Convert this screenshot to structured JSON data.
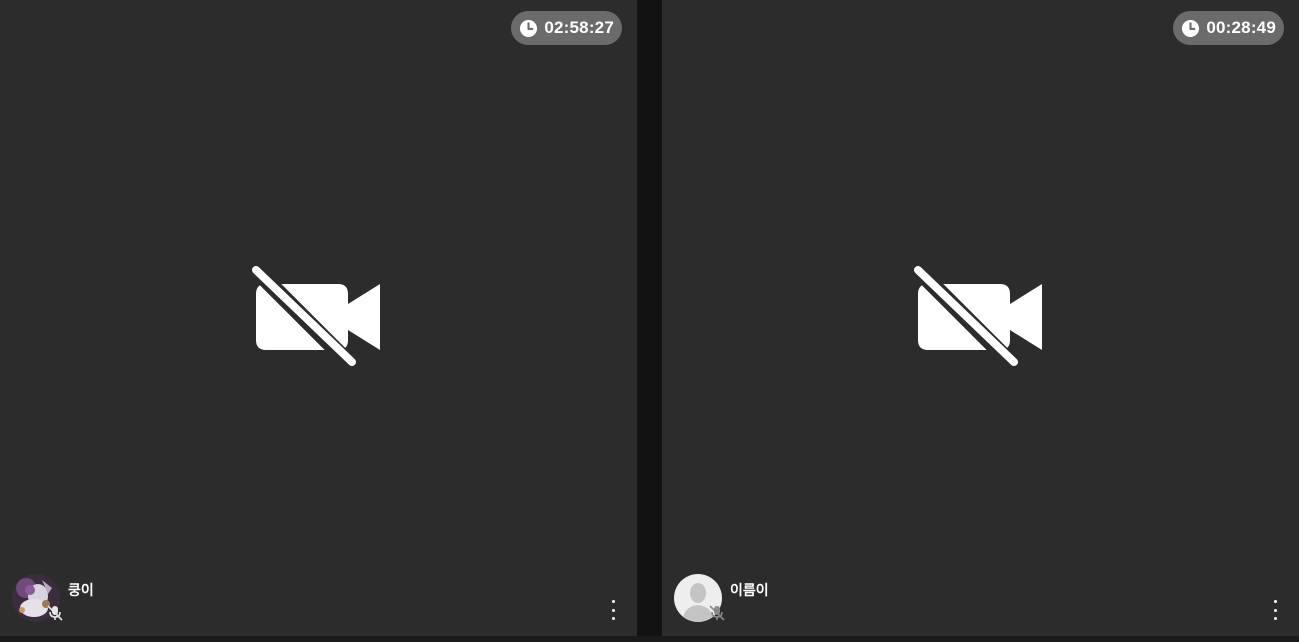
{
  "participants": [
    {
      "name": "쿵이",
      "timer": "02:58:27",
      "avatar_icon": "custom-photo-avatar",
      "camera_icon": "video-off-icon",
      "mic_icon": "mic-off-icon"
    },
    {
      "name": "이름이",
      "timer": "00:28:49",
      "avatar_icon": "default-person-avatar",
      "camera_icon": "video-off-icon",
      "mic_icon": "mic-off-icon"
    }
  ],
  "colors": {
    "tile_bg": "#2c2c2c",
    "page_bg": "#121212",
    "timer_bg": "#6b6b6b",
    "icon": "#ffffff"
  }
}
